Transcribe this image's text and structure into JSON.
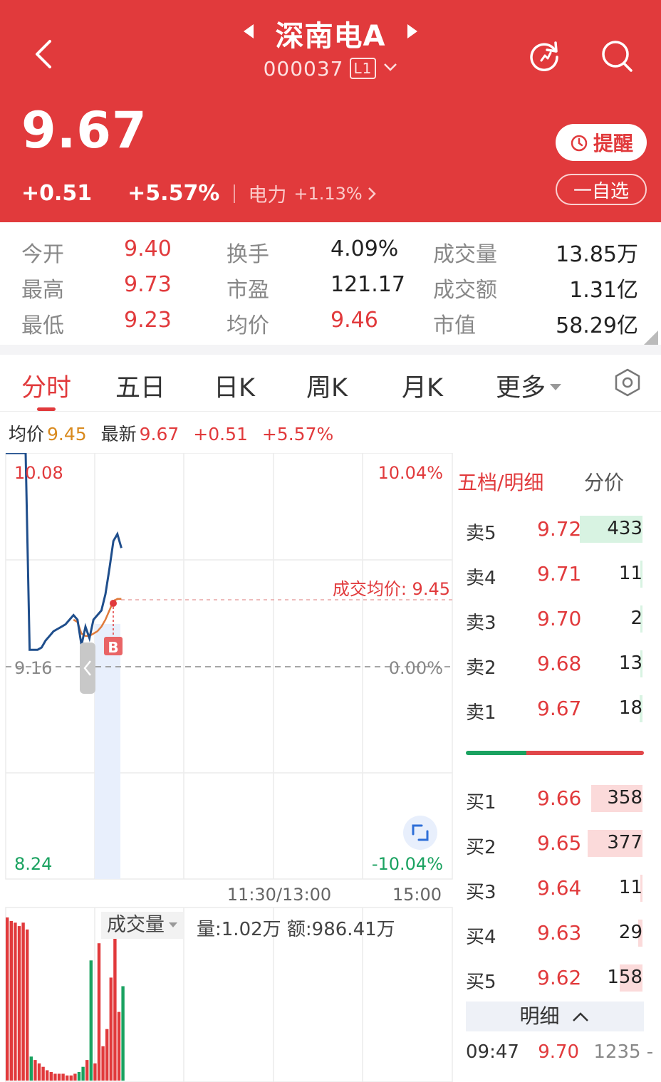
{
  "header": {
    "stock_name": "深南电A",
    "code": "000037",
    "level_badge": "L1",
    "price": "9.67",
    "change": "+0.51",
    "change_pct": "+5.57%",
    "sector": "电力",
    "sector_change": "+1.13%",
    "remind_label": "提醒",
    "watch_label": "一自选"
  },
  "stats": [
    [
      {
        "label": "今开",
        "value": "9.40",
        "color": "red"
      },
      {
        "label": "换手",
        "value": "4.09%",
        "color": "dark"
      },
      {
        "label": "成交量",
        "value": "13.85万",
        "color": "dark"
      }
    ],
    [
      {
        "label": "最高",
        "value": "9.73",
        "color": "red"
      },
      {
        "label": "市盈",
        "value": "121.17",
        "color": "dark"
      },
      {
        "label": "成交额",
        "value": "1.31亿",
        "color": "dark"
      }
    ],
    [
      {
        "label": "最低",
        "value": "9.23",
        "color": "red"
      },
      {
        "label": "均价",
        "value": "9.46",
        "color": "red"
      },
      {
        "label": "市值",
        "value": "58.29亿",
        "color": "dark"
      }
    ]
  ],
  "tabs": [
    "分时",
    "五日",
    "日K",
    "周K",
    "月K",
    "更多"
  ],
  "active_tab": 0,
  "info_line": {
    "avg_label": "均价",
    "avg_value": "9.45",
    "latest_label": "最新",
    "latest_value": "9.67",
    "change": "+0.51",
    "change_pct": "+5.57%"
  },
  "chart": {
    "price_high": "10.08",
    "price_mid": "9.16",
    "price_low": "8.24",
    "pct_high": "10.04%",
    "pct_mid": "0.00%",
    "pct_low": "-10.04%",
    "avg_annotation": "成交均价: 9.45",
    "buy_marker": "B",
    "time_mid": "11:30/13:00",
    "time_end": "15:00",
    "volume_label": "成交量",
    "volume_info": "量:1.02万 额:986.41万"
  },
  "chart_data": {
    "type": "line",
    "prev_close": 9.16,
    "ylim": [
      8.24,
      10.08
    ],
    "pct_range": [
      -10.04,
      10.04
    ],
    "xlabels": [
      "11:30/13:00",
      "15:00"
    ],
    "series": [
      {
        "values": [
          10.08,
          10.08,
          10.08,
          10.08,
          10.08,
          10.08,
          9.23,
          9.23,
          9.23,
          9.24,
          9.27,
          9.29,
          9.31,
          9.32,
          9.33,
          9.34,
          9.36,
          9.38,
          9.36,
          9.25,
          9.33,
          9.28,
          9.36,
          9.38,
          9.4,
          9.47,
          9.58,
          9.7,
          9.73,
          9.67
        ]
      },
      {
        "values": [
          null,
          null,
          null,
          null,
          null,
          null,
          null,
          null,
          null,
          null,
          null,
          null,
          null,
          null,
          null,
          null,
          null,
          9.36,
          9.35,
          9.3,
          9.29,
          9.29,
          9.3,
          9.31,
          9.33,
          9.36,
          9.4,
          9.44,
          9.45,
          9.45
        ]
      }
    ],
    "volume": [
      95,
      93,
      92,
      90,
      92,
      88,
      14,
      12,
      10,
      8,
      6,
      5,
      4,
      4,
      4,
      3,
      3,
      4,
      5,
      8,
      12,
      70,
      10,
      80,
      20,
      30,
      60,
      90,
      40,
      55
    ]
  },
  "order_book": {
    "tab_active": "五档/明细",
    "tab_other": "分价",
    "asks": [
      {
        "label": "卖5",
        "price": "9.72",
        "volume": "433",
        "share": 1.0
      },
      {
        "label": "卖4",
        "price": "9.71",
        "volume": "11",
        "share": 0.025
      },
      {
        "label": "卖3",
        "price": "9.70",
        "volume": "2",
        "share": 0.005
      },
      {
        "label": "卖2",
        "price": "9.68",
        "volume": "13",
        "share": 0.03
      },
      {
        "label": "卖1",
        "price": "9.67",
        "volume": "18",
        "share": 0.04
      }
    ],
    "bids": [
      {
        "label": "买1",
        "price": "9.66",
        "volume": "358",
        "share": 0.82
      },
      {
        "label": "买2",
        "price": "9.65",
        "volume": "377",
        "share": 0.87
      },
      {
        "label": "买3",
        "price": "9.64",
        "volume": "11",
        "share": 0.025
      },
      {
        "label": "买4",
        "price": "9.63",
        "volume": "29",
        "share": 0.067
      },
      {
        "label": "买5",
        "price": "9.62",
        "volume": "158",
        "share": 0.36
      }
    ],
    "buy_ratio": 0.34,
    "detail_label": "明细",
    "tick": {
      "time": "09:47",
      "price": "9.70",
      "volume": "1235"
    }
  },
  "colors": {
    "brand_red": "#e13a3c",
    "up": "#e13a3c",
    "down": "#1aa260",
    "price_line": "#1f4e8c",
    "avg_line": "#e07a3a"
  }
}
